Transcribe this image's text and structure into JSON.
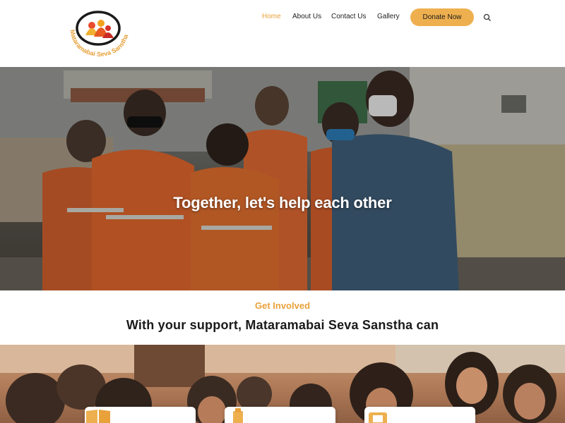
{
  "logo": {
    "text": "Mataramabai Seva Sanstha",
    "brand_color": "#e9a13a"
  },
  "nav": {
    "items": [
      {
        "label": "Home",
        "active": true
      },
      {
        "label": "About Us",
        "active": false
      },
      {
        "label": "Contact Us",
        "active": false
      },
      {
        "label": "Gallery",
        "active": false
      }
    ],
    "donate_label": "Donate Now",
    "search_icon": "search-icon"
  },
  "hero": {
    "title": "Together, let's help each other"
  },
  "involved": {
    "label": "Get Involved",
    "heading": "With your support, Mataramabai Seva Sanstha can"
  },
  "cards": [
    {
      "icon": "book-icon"
    },
    {
      "icon": "clipboard-icon"
    },
    {
      "icon": "gallery-icon"
    }
  ],
  "colors": {
    "accent": "#e9a13a",
    "button": "#eeb04f"
  }
}
